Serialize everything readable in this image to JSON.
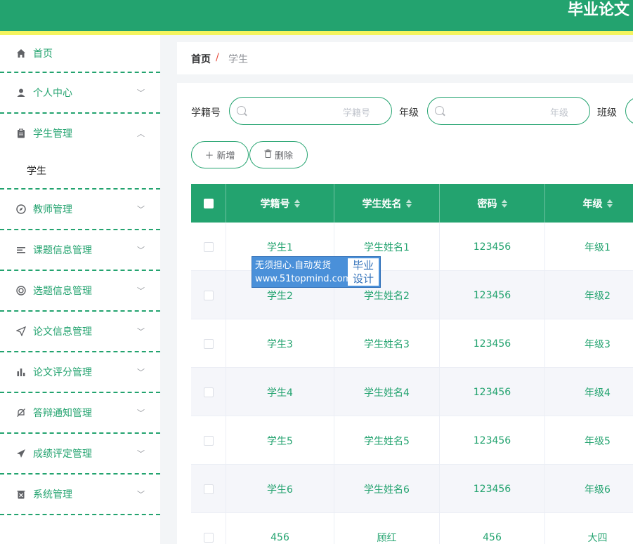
{
  "header": {
    "title": "毕业论文"
  },
  "sidebar": {
    "home": "首页",
    "items": [
      {
        "label": "个人中心",
        "icon": "user-icon"
      },
      {
        "label": "学生管理",
        "icon": "clipboard-icon",
        "expanded": true,
        "sub": "学生"
      },
      {
        "label": "教师管理",
        "icon": "compass-icon"
      },
      {
        "label": "课题信息管理",
        "icon": "list-icon"
      },
      {
        "label": "选题信息管理",
        "icon": "lifebuoy-icon"
      },
      {
        "label": "论文信息管理",
        "icon": "send-icon"
      },
      {
        "label": "论文评分管理",
        "icon": "bar-chart-icon"
      },
      {
        "label": "答辩通知管理",
        "icon": "bell-off-icon"
      },
      {
        "label": "成绩评定管理",
        "icon": "paper-plane-icon"
      },
      {
        "label": "系统管理",
        "icon": "trash-icon"
      }
    ]
  },
  "breadcrumb": {
    "home": "首页",
    "sep": "/",
    "current": "学生"
  },
  "filters": [
    {
      "label": "学籍号",
      "placeholder": "学籍号"
    },
    {
      "label": "年级",
      "placeholder": "年级"
    },
    {
      "label": "班级",
      "placeholder": ""
    }
  ],
  "actions": {
    "add": "新增",
    "delete": "删除"
  },
  "table": {
    "headers": [
      "学籍号",
      "学生姓名",
      "密码",
      "年级"
    ],
    "rows": [
      [
        "学生1",
        "学生姓名1",
        "123456",
        "年级1"
      ],
      [
        "学生2",
        "学生姓名2",
        "123456",
        "年级2"
      ],
      [
        "学生3",
        "学生姓名3",
        "123456",
        "年级3"
      ],
      [
        "学生4",
        "学生姓名4",
        "123456",
        "年级4"
      ],
      [
        "学生5",
        "学生姓名5",
        "123456",
        "年级5"
      ],
      [
        "学生6",
        "学生姓名6",
        "123456",
        "年级6"
      ],
      [
        "456",
        "顾红",
        "456",
        "大四"
      ]
    ]
  },
  "watermark": {
    "line1": "无须担心.自动发货",
    "line2": "www.51topmind.com",
    "tag1": "毕业",
    "tag2": "设计"
  },
  "colors": {
    "primary": "#23a36f",
    "accent": "#f4f45e"
  }
}
